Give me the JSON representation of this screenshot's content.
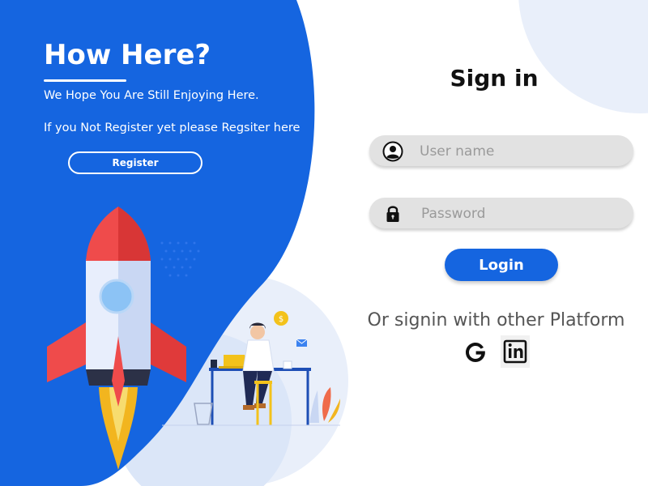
{
  "hero": {
    "title": "How Here?",
    "line1": "We Hope You Are Still Enjoying Here.",
    "line2": "If you Not Register yet please Regsiter here",
    "register_label": "Register"
  },
  "signin": {
    "title": "Sign in",
    "username_placeholder": "User name",
    "password_placeholder": "Password",
    "login_label": "Login",
    "alt_text": "Or signin with other Platform",
    "google_icon": "google-icon",
    "linkedin_icon": "linkedin-icon"
  },
  "colors": {
    "primary_blue": "#1565e0",
    "light_blue": "#e8effc",
    "field_gray": "#e2e2e2",
    "rocket_red": "#ef4b4b"
  }
}
